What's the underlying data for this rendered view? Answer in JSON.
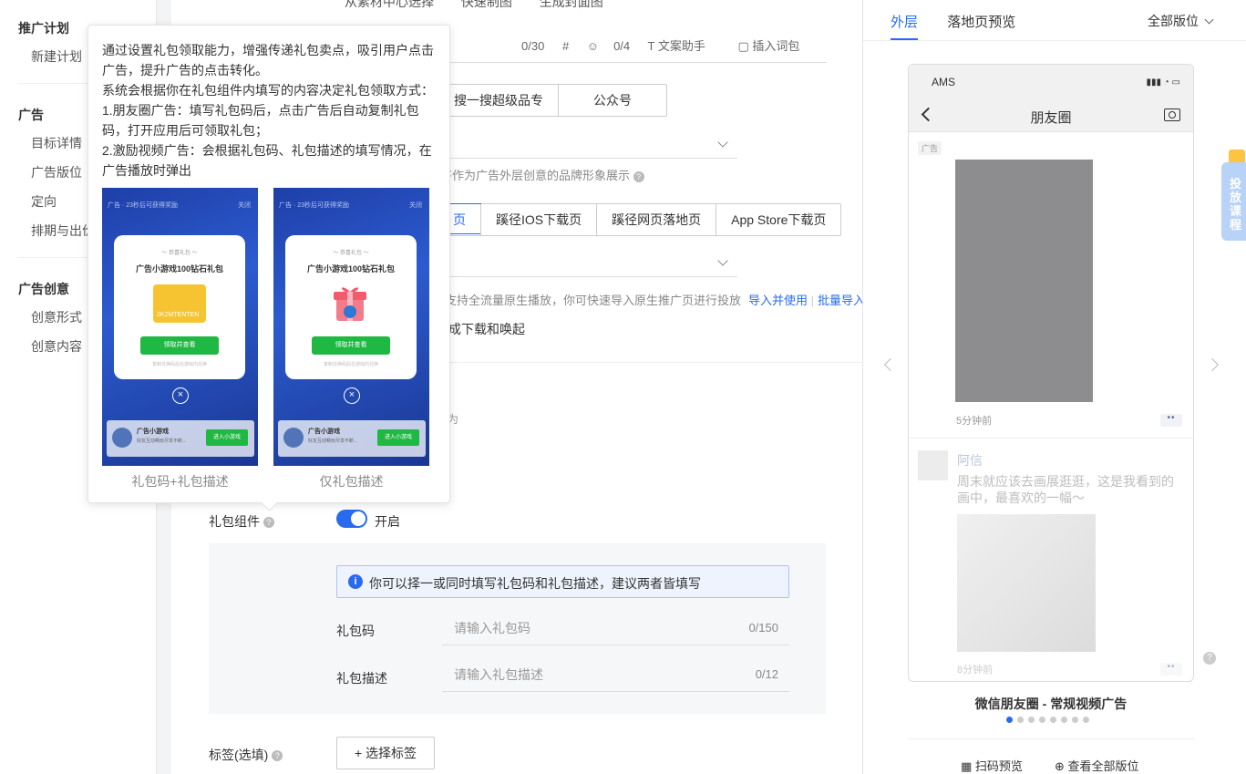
{
  "leftnav": {
    "groups": [
      {
        "title": "推广计划",
        "items": [
          "新建计划"
        ]
      },
      {
        "title": "广告",
        "items": [
          "目标详情",
          "广告版位",
          "定向",
          "排期与出价"
        ]
      },
      {
        "title": "广告创意",
        "items": [
          "创意形式",
          "创意内容"
        ]
      }
    ]
  },
  "main": {
    "top_actions": [
      "从素材中心选择",
      "快速制图",
      "生成封面图"
    ],
    "text_tools": {
      "count1": "0/30",
      "count2": "0/4",
      "assistant": "文案助手",
      "insert": "插入词包"
    },
    "seg1": [
      "搜一搜超级品专",
      "公众号"
    ],
    "brand_hint": "将作为广告外层创意的品牌形象展示",
    "seg2": [
      "页",
      "蹊径IOS下载页",
      "蹊径网页落地页",
      "App Store下载页"
    ],
    "native_hint": "支持全流量原生播放，你可快速导入原生推广页进行投放",
    "import_use": "导入并使用",
    "batch_import": "批量导入",
    "download_text": "成下载和唤起",
    "partial_text": "为",
    "gift_label": "礼包组件",
    "toggle_label": "开启",
    "info_text": "你可以择一或同时填写礼包码和礼包描述，建议两者皆填写",
    "code_label": "礼包码",
    "code_placeholder": "请输入礼包码",
    "code_count": "0/150",
    "desc_label": "礼包描述",
    "desc_placeholder": "请输入礼包描述",
    "desc_count": "0/12",
    "tag_label": "标签(选填)",
    "tag_button": "+ 选择标签"
  },
  "tooltip": {
    "lines": [
      "通过设置礼包领取能力，增强传递礼包卖点，吸引用户点击广告，提升广告的点击转化。",
      "系统会根据你在礼包组件内填写的内容决定礼包领取方式：",
      "1.朋友圈广告：填写礼包码后，点击广告后自动复制礼包码，打开应用后可领取礼包；",
      "2.激励视频广告：会根据礼包码、礼包描述的填写情况，在广告播放时弹出"
    ],
    "examples": [
      {
        "caption": "礼包码+礼包描述",
        "ad_bar": "广告 · 23秒后可获得奖励",
        "close": "关闭",
        "small": "～ 恭喜礼包 ～",
        "title": "广告小游戏100钻石礼包",
        "code": "2K2MTENTEN",
        "btn": "领取并查看",
        "foot": "复制兑换码后在游戏内兑换",
        "app": "广告小游戏",
        "app_sub": "好友互动畅玩尽享不断...",
        "enter": "进入小游戏"
      },
      {
        "caption": "仅礼包描述",
        "ad_bar": "广告 · 23秒后可获得奖励",
        "close": "关闭",
        "small": "～ 恭喜礼包 ～",
        "title": "广告小游戏100钻石礼包",
        "code": "",
        "btn": "领取并查看",
        "foot": "复制兑换码后在游戏内兑换",
        "app": "广告小游戏",
        "app_sub": "好友互动畅玩尽享不断...",
        "enter": "进入小游戏"
      }
    ]
  },
  "preview": {
    "tab1": "外层",
    "tab2": "落地页预览",
    "position_select": "全部版位",
    "status_carrier": "AMS",
    "nav_title": "朋友圈",
    "ad_tag": "广告",
    "time1": "5分钟前",
    "friend_name": "阿信",
    "friend_text": "周末就应该去画展逛逛，这是我看到的画中，最喜欢的一幅～",
    "time2": "8分钟前",
    "title": "微信朋友圈 - 常规视频广告",
    "scan": "扫码预览",
    "view_all": "查看全部版位",
    "dots_active": 0,
    "dots_count": 8
  },
  "float_tab": "投放课程"
}
